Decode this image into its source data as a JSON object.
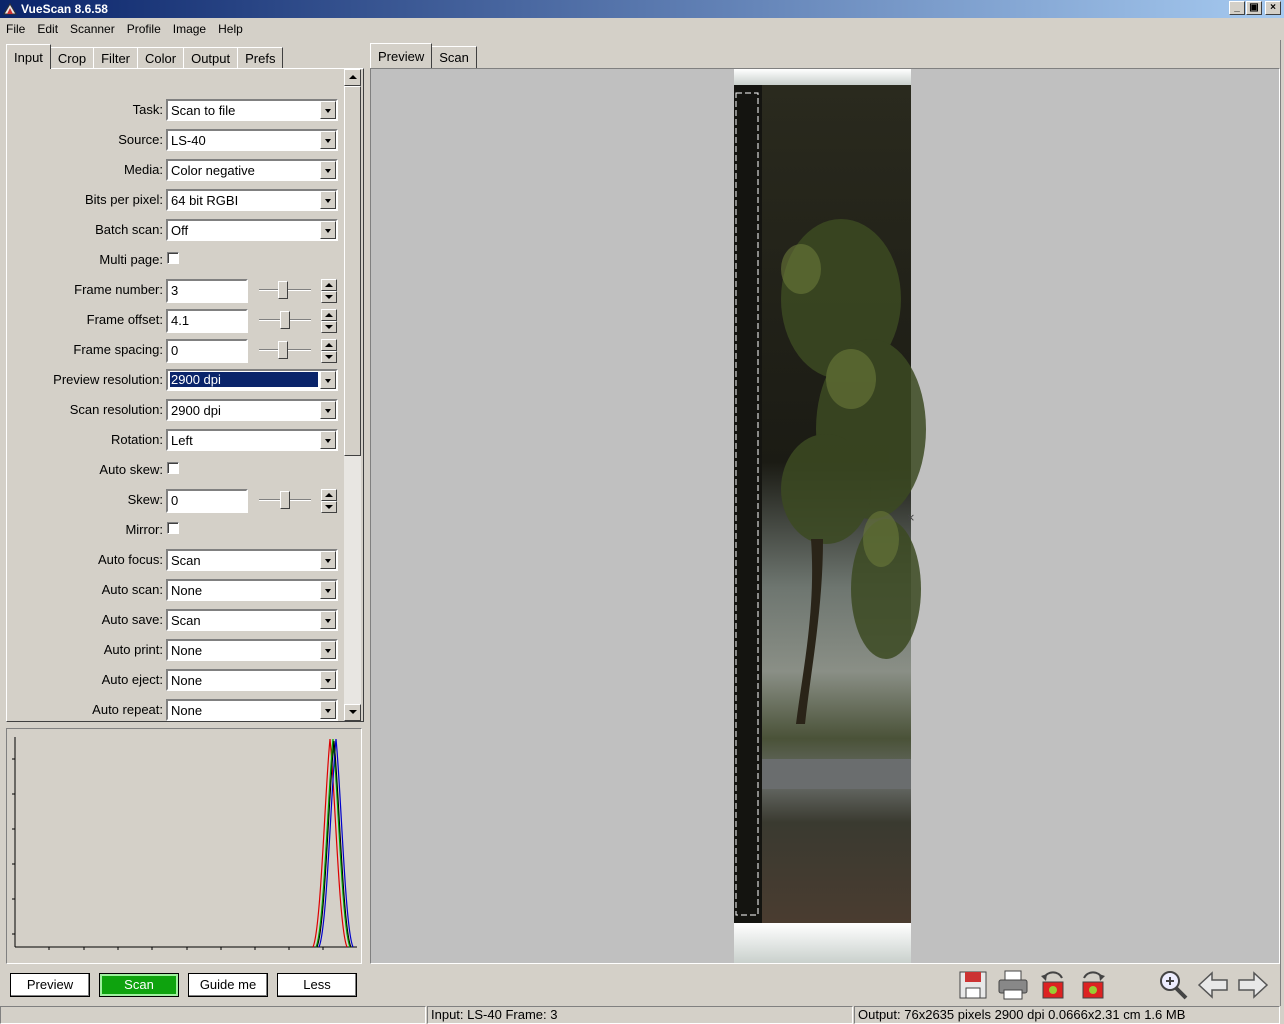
{
  "window": {
    "title": "VueScan 8.6.58"
  },
  "menu": [
    "File",
    "Edit",
    "Scanner",
    "Profile",
    "Image",
    "Help"
  ],
  "left_tabs": [
    "Input",
    "Crop",
    "Filter",
    "Color",
    "Output",
    "Prefs"
  ],
  "right_tabs": [
    "Preview",
    "Scan"
  ],
  "settings": [
    {
      "label": "Task:",
      "type": "combo",
      "value": "Scan to file"
    },
    {
      "label": "Source:",
      "type": "combo",
      "value": "LS-40"
    },
    {
      "label": "Media:",
      "type": "combo",
      "value": "Color negative"
    },
    {
      "label": "Bits per pixel:",
      "type": "combo",
      "value": "64 bit RGBI"
    },
    {
      "label": "Batch scan:",
      "type": "combo",
      "value": "Off"
    },
    {
      "label": "Multi page:",
      "type": "checkbox",
      "value": ""
    },
    {
      "label": "Frame number:",
      "type": "spin",
      "value": "3",
      "slider": 0.45
    },
    {
      "label": "Frame offset:",
      "type": "spin",
      "value": "4.1",
      "slider": 0.5
    },
    {
      "label": "Frame spacing:",
      "type": "spin",
      "value": "0",
      "slider": 0.45
    },
    {
      "label": "Preview resolution:",
      "type": "combo",
      "value": "2900 dpi",
      "selected": true
    },
    {
      "label": "Scan resolution:",
      "type": "combo",
      "value": "2900 dpi"
    },
    {
      "label": "Rotation:",
      "type": "combo",
      "value": "Left"
    },
    {
      "label": "Auto skew:",
      "type": "checkbox",
      "value": ""
    },
    {
      "label": "Skew:",
      "type": "spin",
      "value": "0",
      "slider": 0.5
    },
    {
      "label": "Mirror:",
      "type": "checkbox",
      "value": ""
    },
    {
      "label": "Auto focus:",
      "type": "combo",
      "value": "Scan"
    },
    {
      "label": "Auto scan:",
      "type": "combo",
      "value": "None"
    },
    {
      "label": "Auto save:",
      "type": "combo",
      "value": "Scan"
    },
    {
      "label": "Auto print:",
      "type": "combo",
      "value": "None"
    },
    {
      "label": "Auto eject:",
      "type": "combo",
      "value": "None"
    },
    {
      "label": "Auto repeat:",
      "type": "combo",
      "value": "None"
    }
  ],
  "buttons": {
    "preview": "Preview",
    "scan": "Scan",
    "guide": "Guide me",
    "less": "Less"
  },
  "toolbar_icons": [
    "save-icon",
    "print-icon",
    "rotate-left-icon",
    "rotate-right-icon",
    "zoom-icon",
    "previous-frame-icon",
    "next-frame-icon"
  ],
  "status": {
    "input": "Input: LS-40 Frame: 3",
    "output": "Output: 76x2635 pixels 2900 dpi 0.0666x2.31 cm 1.6 MB"
  },
  "colors": {
    "scan_button": "#0ea30e",
    "selection": "#0a246a",
    "preview_bg": "#c0c0c0"
  }
}
